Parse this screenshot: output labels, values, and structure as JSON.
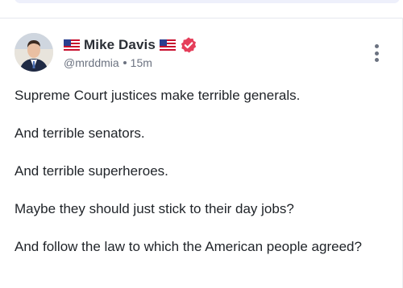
{
  "post": {
    "author": {
      "display_name": "Mike Davis",
      "handle": "@mrddmia",
      "avatar_icon": "avatar-photo"
    },
    "time_ago": "15m",
    "verified_color": "#e53e5a",
    "paragraphs": [
      "Supreme Court justices make terrible generals.",
      "And terrible senators.",
      "And terrible superheroes.",
      "Maybe they should just stick to their day jobs?",
      "And follow the law to which the American people agreed?"
    ]
  }
}
